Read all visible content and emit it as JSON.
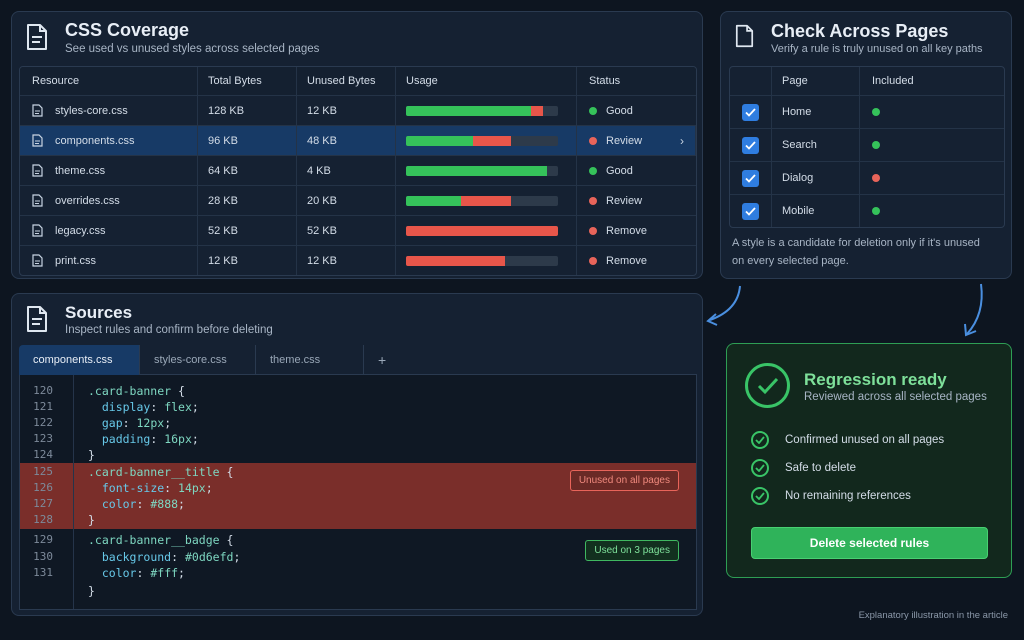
{
  "coverage": {
    "title": "CSS Coverage",
    "subtitle": "See used vs unused styles across selected pages",
    "columns": [
      "Resource",
      "Total Bytes",
      "Unused Bytes",
      "Usage",
      "Status"
    ],
    "rows": [
      {
        "file": "styles-core.css",
        "total": "128 KB",
        "unused": "12 KB",
        "used_fraction": 0.82,
        "unused_fraction": 0.08,
        "status": "Good",
        "status_color": "#35c25a"
      },
      {
        "file": "components.css",
        "total": "96 KB",
        "unused": "48 KB",
        "used_fraction": 0.44,
        "unused_fraction": 0.25,
        "status": "Review",
        "status_color": "#e8645a"
      },
      {
        "file": "theme.css",
        "total": "64 KB",
        "unused": "4 KB",
        "used_fraction": 0.93,
        "unused_fraction": 0.0,
        "status": "Good",
        "status_color": "#35c25a"
      },
      {
        "file": "overrides.css",
        "total": "28 KB",
        "unused": "20 KB",
        "used_fraction": 0.36,
        "unused_fraction": 0.33,
        "status": "Review",
        "status_color": "#e8645a"
      },
      {
        "file": "legacy.css",
        "total": "52 KB",
        "unused": "52 KB",
        "used_fraction": 0.0,
        "unused_fraction": 1.0,
        "status": "Remove",
        "status_color": "#e8645a"
      },
      {
        "file": "print.css",
        "total": "12 KB",
        "unused": "12 KB",
        "used_fraction": 0.0,
        "unused_fraction": 0.65,
        "status": "Remove",
        "status_color": "#e8645a"
      }
    ]
  },
  "pages": {
    "title": "Check Across Pages",
    "subtitle": "Verify a rule is truly unused on all key paths",
    "columns": [
      "Page",
      "Included"
    ],
    "rows": [
      {
        "name": "Home",
        "dot_color": "#35c25a"
      },
      {
        "name": "Search",
        "dot_color": "#35c25a"
      },
      {
        "name": "Dialog",
        "dot_color": "#e8645a"
      },
      {
        "name": "Mobile",
        "dot_color": "#35c25a"
      }
    ],
    "note": "A style is a candidate for deletion only if it's unused on every selected page."
  },
  "sources": {
    "title": "Sources",
    "subtitle": "Inspect rules and confirm before deleting",
    "tabs": [
      "components.css",
      "styles-core.css",
      "theme.css",
      "+"
    ],
    "lines": [
      {
        "n": "120",
        "text": ".card-banner {"
      },
      {
        "n": "121",
        "text": "  display: flex;"
      },
      {
        "n": "122",
        "text": "  gap: 12px;"
      },
      {
        "n": "123",
        "text": "  padding: 16px;"
      },
      {
        "n": "124",
        "text": "}"
      },
      {
        "n": "125",
        "text": ".card-banner__title {"
      },
      {
        "n": "126",
        "text": "  font-size: 14px;"
      },
      {
        "n": "127",
        "text": "  color: #888;"
      },
      {
        "n": "128",
        "text": "}"
      },
      {
        "n": "129",
        "text": ".card-banner__badge {"
      },
      {
        "n": "130",
        "text": "  background: #0d6efd;"
      },
      {
        "n": "131",
        "text": "  color: #fff;"
      },
      {
        "n": "",
        "text": "}"
      }
    ],
    "badge_unused": "Unused on all pages",
    "badge_used": "Used on 3 pages"
  },
  "regression": {
    "title": "Regression ready",
    "subtitle": "Reviewed across all selected pages",
    "items": [
      "Confirmed unused on all pages",
      "Safe to delete",
      "No remaining references"
    ],
    "button": "Delete selected rules"
  },
  "footer": "Explanatory illustration in the article",
  "colors": {
    "accent": "#2f7de0",
    "good": "#35c25a",
    "bad": "#e8564a"
  }
}
